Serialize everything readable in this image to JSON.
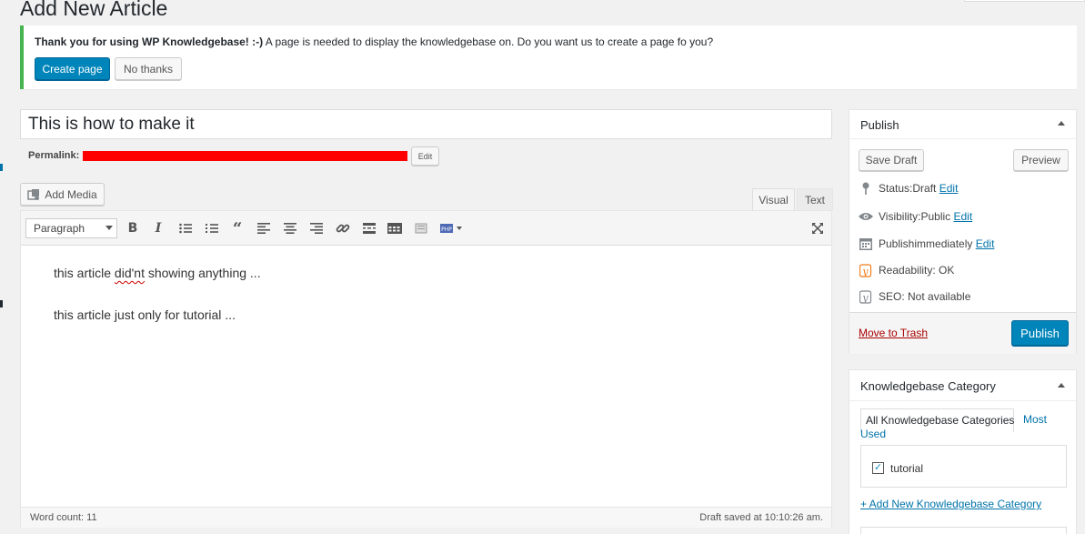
{
  "page": {
    "title": "Add New Article"
  },
  "notice": {
    "strong": "Thank you for using WP Knowledgebase! :-)",
    "message": " A page is needed to display the knowledgebase on. Do you want us to create a page fo you?",
    "create_label": "Create page",
    "dismiss_label": "No thanks"
  },
  "post": {
    "title": "This is how to make it",
    "permalink_label": "Permalink:",
    "permalink_edit": "Edit"
  },
  "editor": {
    "add_media": "Add Media",
    "tabs": {
      "visual": "Visual",
      "text": "Text"
    },
    "format": "Paragraph",
    "toolbar_icons": [
      "bold-icon",
      "italic-icon",
      "bullet-list-icon",
      "numbered-list-icon",
      "blockquote-icon",
      "align-left-icon",
      "align-center-icon",
      "align-right-icon",
      "link-icon",
      "read-more-icon",
      "toolbar-toggle-icon",
      "insert-icon",
      "php-icon",
      "fullscreen-icon"
    ],
    "content": {
      "line1_pre": "this article ",
      "line1_err": "did'nt",
      "line1_post": " showing anything ...",
      "line2": "this article just only for tutorial ..."
    },
    "word_count": "Word count: 11",
    "draft_saved": "Draft saved at 10:10:26 am."
  },
  "publish": {
    "title": "Publish",
    "save_draft": "Save Draft",
    "preview": "Preview",
    "status_label": "Status: ",
    "status_value": "Draft",
    "visibility_label": "Visibility: ",
    "visibility_value": "Public",
    "schedule_label": "Publish ",
    "schedule_value": "immediately",
    "edit": "Edit",
    "readability": "Readability: OK",
    "seo": "SEO: Not available",
    "trash": "Move to Trash",
    "publish_btn": "Publish"
  },
  "category": {
    "title": "Knowledgebase Category",
    "tab_all": "All Knowledgebase Categories",
    "tab_most": "Most Used",
    "items": [
      {
        "label": "tutorial",
        "checked": true
      }
    ],
    "add_new": "+ Add New Knowledgebase Category"
  }
}
